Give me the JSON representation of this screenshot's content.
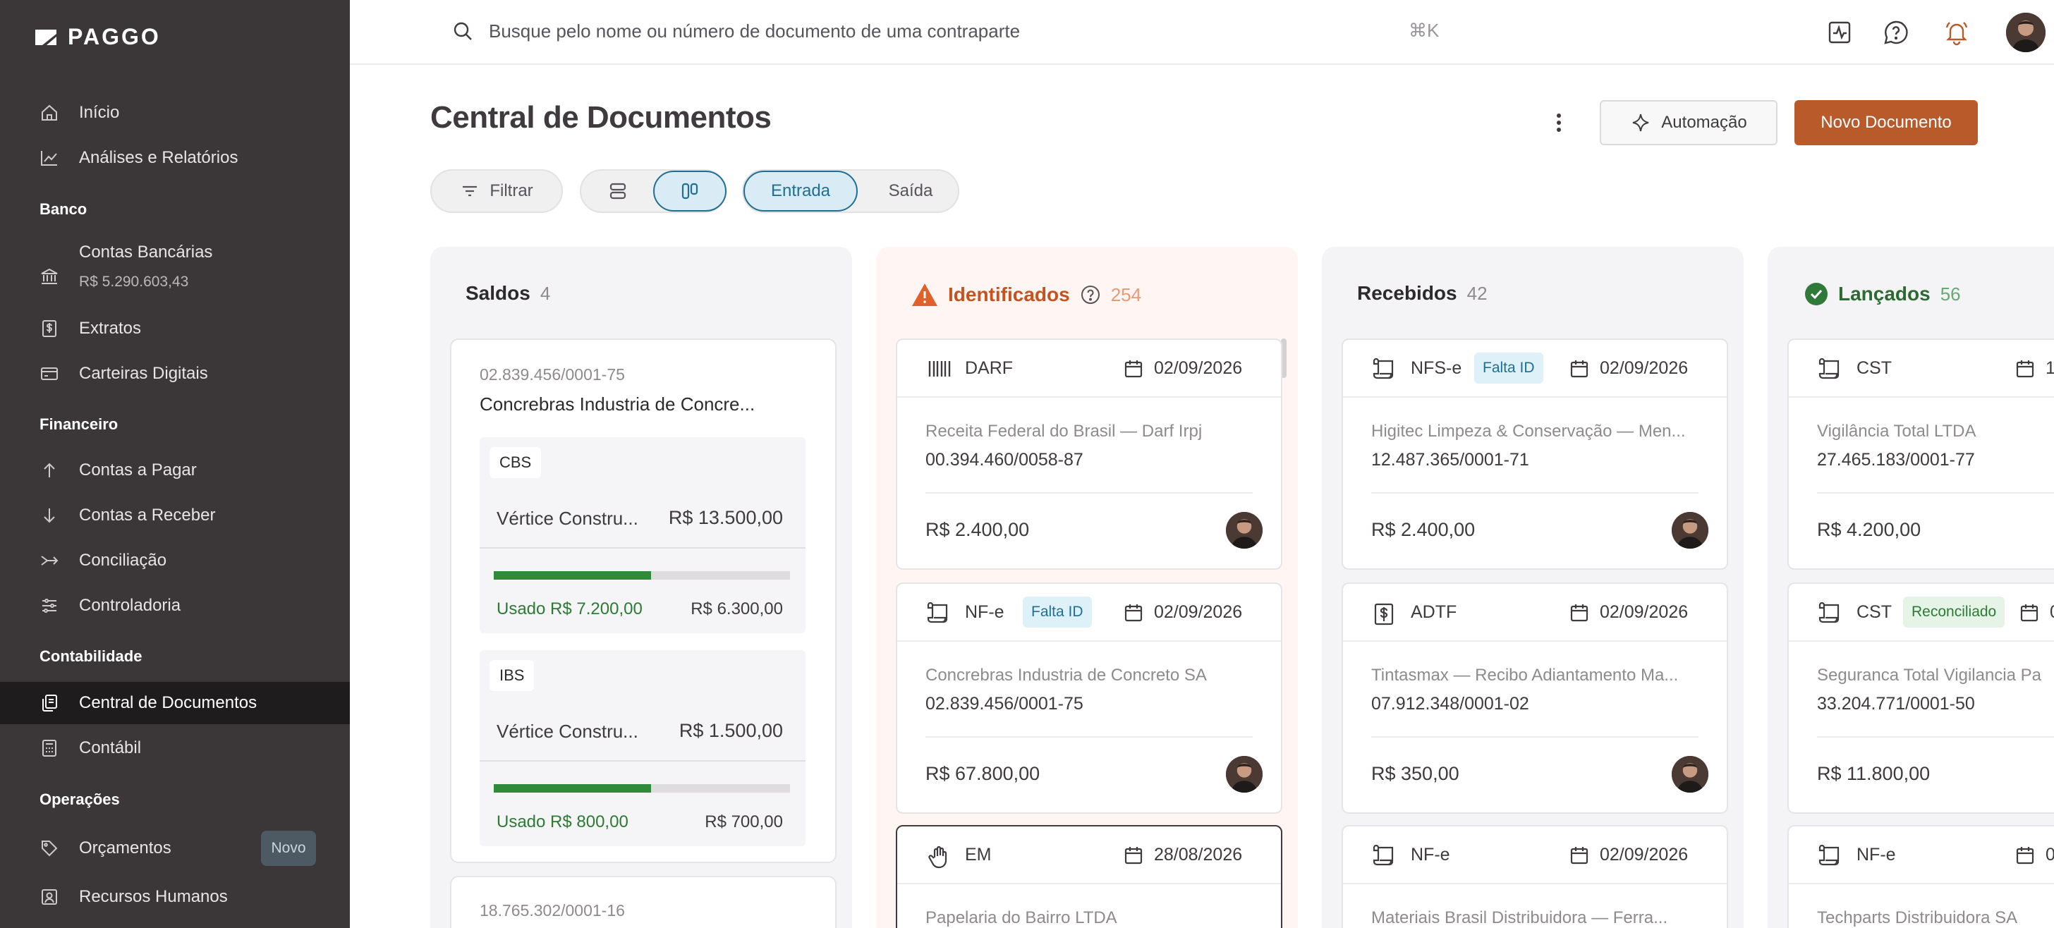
{
  "brand": {
    "name": "PAGGO"
  },
  "sidebar": {
    "items": [
      {
        "label": "Início",
        "icon": "home-icon"
      },
      {
        "label": "Análises e Relatórios",
        "icon": "chart-line-icon"
      }
    ],
    "sections": [
      "Banco",
      "Financeiro",
      "Contabilidade",
      "Operações"
    ],
    "banco": [
      {
        "label": "Contas Bancárias",
        "sub": "R$ 5.290.603,43",
        "icon": "bank-icon"
      },
      {
        "label": "Extratos",
        "icon": "dollar-doc-icon"
      },
      {
        "label": "Carteiras Digitais",
        "icon": "card-icon"
      }
    ],
    "financeiro": [
      {
        "label": "Contas a Pagar",
        "icon": "arrow-up-icon"
      },
      {
        "label": "Contas a Receber",
        "icon": "arrow-down-icon"
      },
      {
        "label": "Conciliação",
        "icon": "merge-icon"
      },
      {
        "label": "Controladoria",
        "icon": "sliders-icon"
      }
    ],
    "contabilidade": [
      {
        "label": "Central de Documentos",
        "icon": "documents-icon",
        "active": true
      },
      {
        "label": "Contábil",
        "icon": "calculator-icon"
      }
    ],
    "operacoes": [
      {
        "label": "Orçamentos",
        "icon": "tag-icon",
        "badge": "Novo"
      },
      {
        "label": "Recursos Humanos",
        "icon": "id-badge-icon"
      }
    ]
  },
  "topbar": {
    "search_placeholder": "Busque pelo nome ou número de documento de uma contraparte",
    "shortcut": "⌘K"
  },
  "header": {
    "title": "Central de Documentos",
    "automation_label": "Automação",
    "new_document_label": "Novo Documento"
  },
  "filters": {
    "filter_label": "Filtrar",
    "tabs": [
      "Entrada",
      "Saída"
    ],
    "active_tab": "Entrada"
  },
  "colors": {
    "accent": "#b85a2a",
    "selected": "#1f6f93",
    "warning": "#e0622a",
    "success": "#2f8a3a"
  },
  "columns": {
    "saldos": {
      "title": "Saldos",
      "count": "4",
      "cards": [
        {
          "cnpj": "02.839.456/0001-75",
          "name": "Concrebras Industria de Concre...",
          "boxes": [
            {
              "chip": "CBS",
              "entity": "Vértice Constru...",
              "value": "R$ 13.500,00",
              "used": "Usado R$ 7.200,00",
              "remaining": "R$ 6.300,00",
              "fraction": 0.53
            },
            {
              "chip": "IBS",
              "entity": "Vértice Constru...",
              "value": "R$ 1.500,00",
              "used": "Usado R$ 800,00",
              "remaining": "R$ 700,00",
              "fraction": 0.53
            }
          ]
        },
        {
          "cnpj": "18.765.302/0001-16"
        }
      ]
    },
    "identificados": {
      "title": "Identificados",
      "count": "254",
      "cards": [
        {
          "type": "DARF",
          "date": "02/09/2026",
          "name": "Receita Federal do Brasil — Darf Irpj",
          "doc": "00.394.460/0058-87",
          "amount": "R$ 2.400,00"
        },
        {
          "type": "NF-e",
          "tag": "Falta ID",
          "date": "02/09/2026",
          "name": "Concrebras Industria de Concreto SA",
          "doc": "02.839.456/0001-75",
          "amount": "R$ 67.800,00"
        },
        {
          "type": "EM",
          "date": "28/08/2026",
          "name": "Papelaria do Bairro LTDA"
        }
      ]
    },
    "recebidos": {
      "title": "Recebidos",
      "count": "42",
      "cards": [
        {
          "type": "NFS-e",
          "tag": "Falta ID",
          "date": "02/09/2026",
          "name": "Higitec Limpeza & Conservação — Men...",
          "doc": "12.487.365/0001-71",
          "amount": "R$ 2.400,00"
        },
        {
          "type": "ADTF",
          "date": "02/09/2026",
          "name": "Tintasmax — Recibo Adiantamento Ma...",
          "doc": "07.912.348/0001-02",
          "amount": "R$ 350,00"
        },
        {
          "type": "NF-e",
          "date": "02/09/2026",
          "name": "Materiais Brasil Distribuidora — Ferra..."
        }
      ]
    },
    "lancados": {
      "title": "Lançados",
      "count": "56",
      "cards": [
        {
          "type": "CST",
          "date": "1",
          "name": "Vigilância Total LTDA",
          "doc": "27.465.183/0001-77",
          "amount": "R$ 4.200,00"
        },
        {
          "type": "CST",
          "tag": "Reconciliado",
          "date": "0",
          "name": "Seguranca Total Vigilancia Pa",
          "doc": "33.204.771/0001-50",
          "amount": "R$ 11.800,00"
        },
        {
          "type": "NF-e",
          "date": "0",
          "name": "Techparts Distribuidora SA"
        }
      ]
    }
  }
}
